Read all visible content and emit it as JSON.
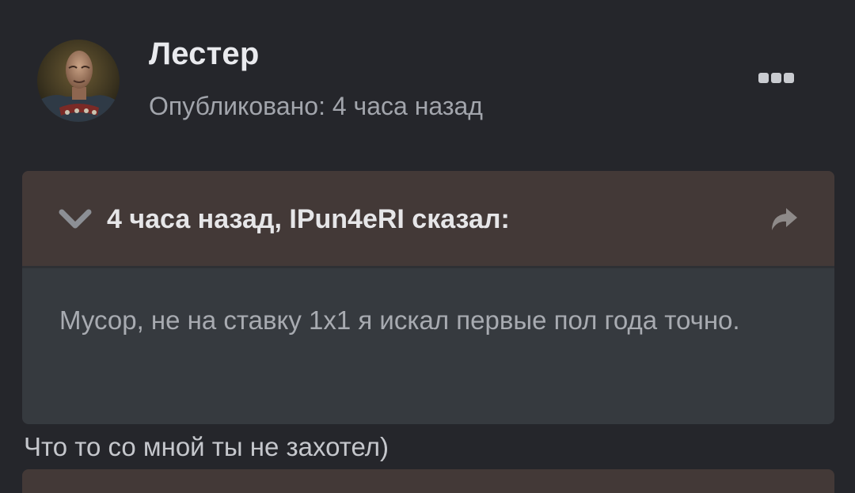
{
  "post": {
    "author_name": "Лестер",
    "published": "Опубликовано: 4 часа назад",
    "reply_text": "Что то со мной ты не захотел)"
  },
  "quote": {
    "header": "4 часа назад, IPun4eRI сказал:",
    "body": "Мусор, не на ставку 1х1 я искал первые пол года точно."
  },
  "colors": {
    "background": "#25262b",
    "quote_header": "#433937",
    "quote_body": "#363a3f"
  },
  "icons": {
    "more": "more-icon",
    "collapse": "chevron-down-icon",
    "share": "share-arrow-icon"
  }
}
